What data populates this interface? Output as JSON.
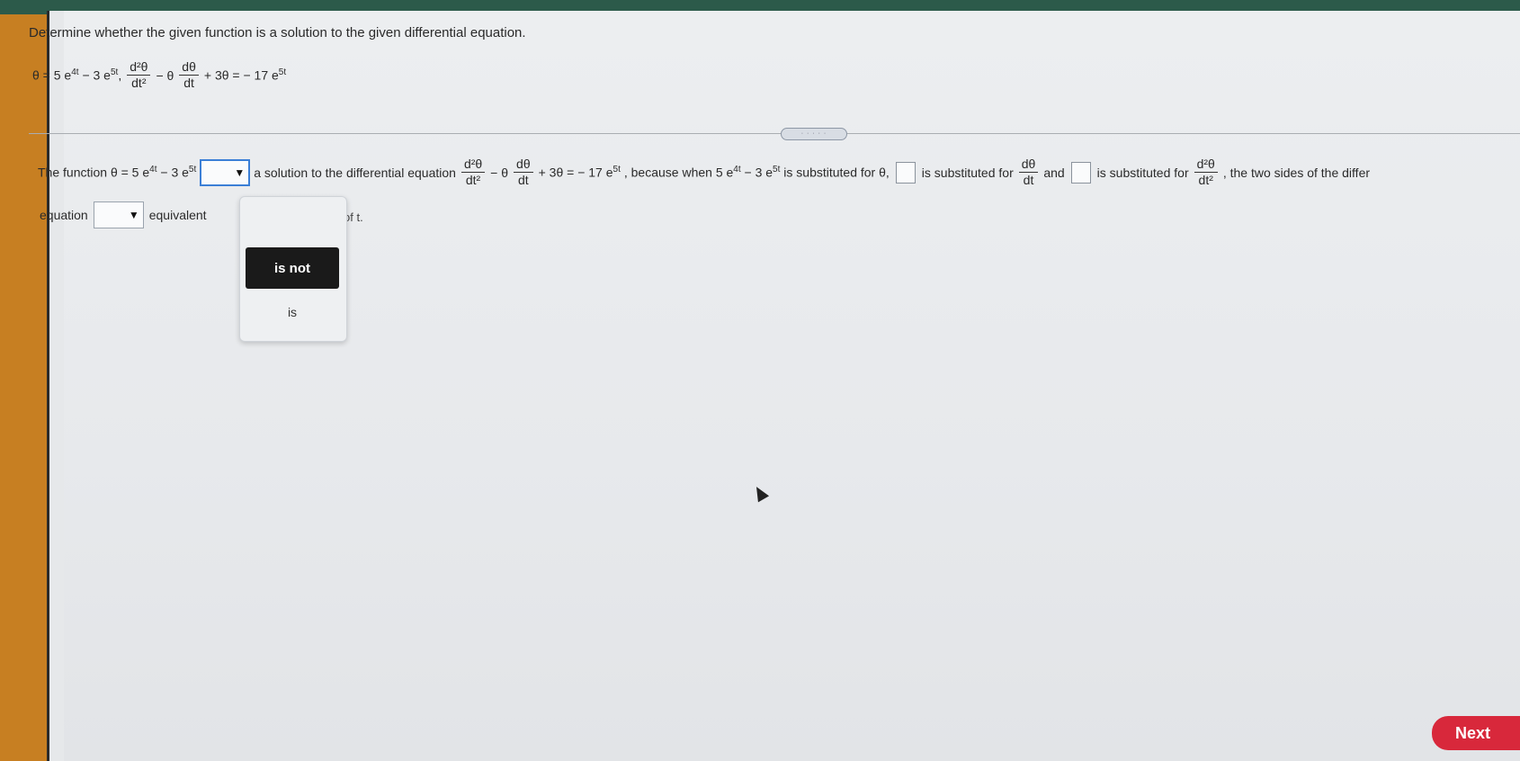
{
  "problem": {
    "instruction": "Determine whether the given function is a solution to the given differential equation.",
    "given_function": "θ = 5 e",
    "given_exp1": "4t",
    "given_mid": "− 3 e",
    "given_exp2": "5t",
    "given_sep": ",",
    "deq": {
      "frac1_num": "d²θ",
      "frac1_den": "dt²",
      "minus_theta": "− θ",
      "frac2_num": "dθ",
      "frac2_den": "dt",
      "rhs": "+ 3θ = − 17 e",
      "rhs_exp": "5t"
    }
  },
  "answer": {
    "part1_a": "The function θ = 5 e",
    "part1_exp1": "4t",
    "part1_b": "− 3 e",
    "part1_exp2": "5t",
    "part2": "a solution to the differential equation",
    "part3_rhs": "+ 3θ = − 17 e",
    "part3_exp": "5t",
    "part4_a": ", because when 5 e",
    "part4_exp1": "4t",
    "part4_b": "− 3 e",
    "part4_exp2": "5t",
    "part4_c": "is substituted for θ,",
    "part5": "is substituted for",
    "part6": "and",
    "part7": "is substituted for",
    "part8": ", the two sides of the differ",
    "line2_a": "equation",
    "line2_b": "equivalent",
    "line2_hidden": "of t.",
    "select_arrow": "▼"
  },
  "dropdown": {
    "options": [
      "is not",
      "is"
    ],
    "highlighted": "is not"
  },
  "buttons": {
    "next": "Next"
  },
  "divider_handle": "· · · · ·"
}
